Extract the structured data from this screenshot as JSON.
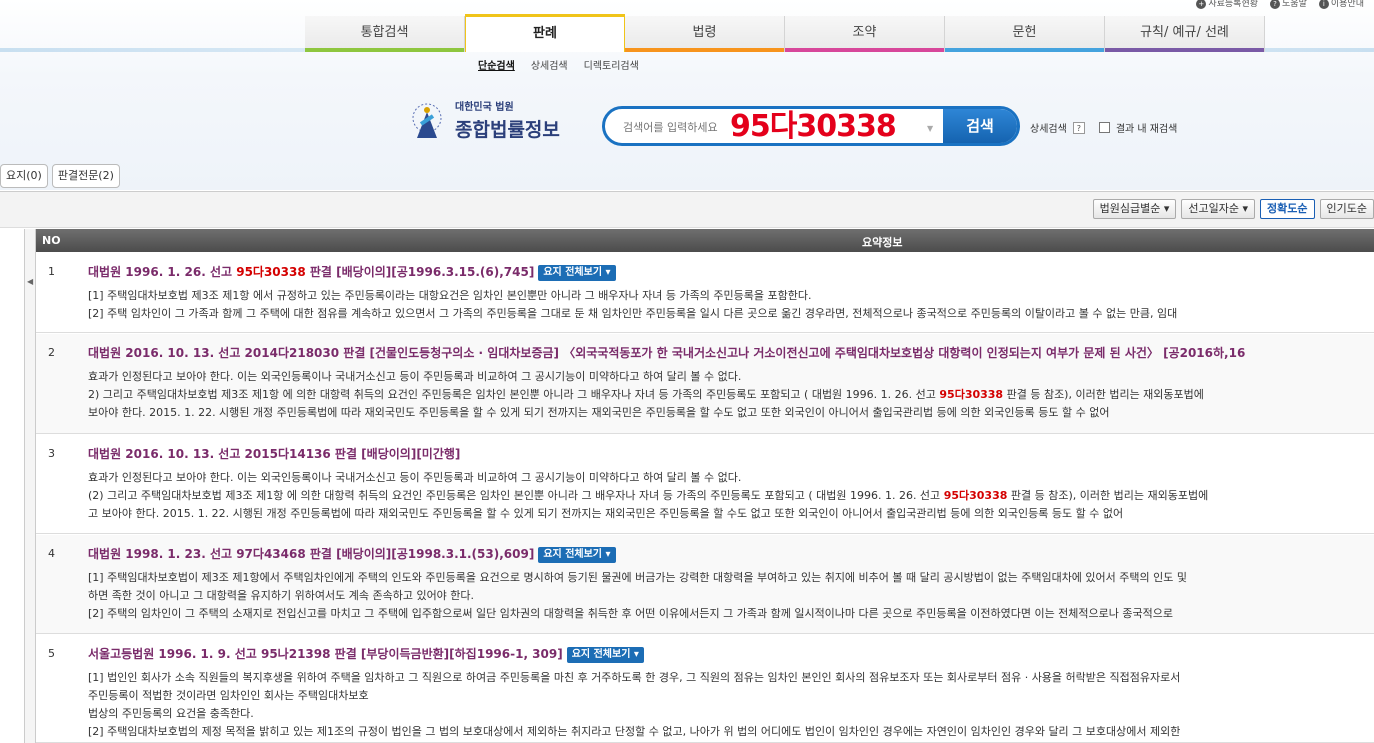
{
  "util": [
    "사료등록현황",
    "도움말",
    "이용안내"
  ],
  "nav": {
    "tabs": [
      {
        "label": "통합검색",
        "color": "#8ec63f"
      },
      {
        "label": "판례",
        "color": "#f0c419",
        "active": true
      },
      {
        "label": "법령",
        "color": "#f7941d"
      },
      {
        "label": "조약",
        "color": "#d7479a"
      },
      {
        "label": "문헌",
        "color": "#45a3de"
      },
      {
        "label": "규칙/ 예규/ 선례",
        "color": "#7a5aa6"
      }
    ],
    "sub": [
      "단순검색",
      "상세검색",
      "디렉토리검색"
    ]
  },
  "logo": {
    "line1": "대한민국 법원",
    "line2": "종합법률정보"
  },
  "search": {
    "placeholder": "검색어를 입력하세요",
    "query": "95다30338",
    "button": "검색"
  },
  "detail": {
    "label": "상세검색",
    "help": "?",
    "recheck": "결과 내 재검색"
  },
  "smalltabs": [
    "요지(0)",
    "판결전문(2)"
  ],
  "sort": [
    "법원심급별순",
    "선고일자순",
    "정확도순",
    "인기도순"
  ],
  "table": {
    "col_no": "NO",
    "col_summary": "요약정보"
  },
  "rows": [
    {
      "no": "1",
      "title_pre": "대법원 1996. 1. 26. 선고 ",
      "title_hl": "95다30338",
      "title_post": " 판결 [배당이의][공1996.3.15.(6),745]",
      "tag": "요지 전체보기 ▾",
      "lines": [
        {
          "t": "[1] 주택임대차보호법 제3조 제1항 에서 규정하고 있는 주민등록이라는 대항요건은 임차인 본인뿐만 아니라 그 배우자나 자녀 등 가족의 주민등록을 포함한다."
        },
        {
          "t": "[2] 주택 임차인이 그 가족과 함께 그 주택에 대한 점유를 계속하고 있으면서 그 가족의 주민등록을 그대로 둔 채 임차인만 주민등록을 일시 다른 곳으로 옮긴 경우라면, 전체적으로나 종국적으로 주민등록의 이탈이라고 볼 수 없는 만큼, 임대"
        }
      ]
    },
    {
      "no": "2",
      "title_pre": "대법원 2016. 10. 13. 선고 2014다218030 판결 [건물인도등청구의소 · 임대차보증금] 〈외국국적동포가 한 국내거소신고나 거소이전신고에 주택임대차보호법상 대항력이 인정되는지 여부가 문제 된 사건〉 [공2016하,16",
      "title_hl": "",
      "title_post": "",
      "tag": "",
      "lines": [
        {
          "t": "효과가 인정된다고 보아야 한다. 이는 외국인등록이나 국내거소신고 등이 주민등록과 비교하여 그 공시기능이 미약하다고 하여 달리 볼 수 없다."
        },
        {
          "pre": "2) 그리고 주택임대차보호법 제3조 제1항 에 의한 대항력 취득의 요건인 주민등록은 임차인 본인뿐 아니라 그 배우자나 자녀 등 가족의 주민등록도 포함되고 ( 대법원 1996. 1. 26. 선고 ",
          "hl": "95다30338",
          "post": " 판결 등 참조), 이러한 법리는 재외동포법에"
        },
        {
          "t": "보아야 한다. 2015. 1. 22. 시행된 개정 주민등록법에 따라 재외국민도 주민등록을 할 수 있게 되기 전까지는 재외국민은 주민등록을 할 수도 없고 또한 외국인이 아니어서 출입국관리법 등에 의한 외국인등록 등도 할 수 없어"
        }
      ]
    },
    {
      "no": "3",
      "title_pre": "대법원 2016. 10. 13. 선고 2015다14136 판결 [배당이의][미간행]",
      "title_hl": "",
      "title_post": "",
      "tag": "",
      "lines": [
        {
          "t": "효과가 인정된다고 보아야 한다. 이는 외국인등록이나 국내거소신고 등이 주민등록과 비교하여 그 공시기능이 미약하다고 하여 달리 볼 수 없다."
        },
        {
          "pre": "(2) 그리고 주택임대차보호법 제3조 제1항 에 의한 대항력 취득의 요건인 주민등록은 임차인 본인뿐 아니라 그 배우자나 자녀 등 가족의 주민등록도 포함되고 ( 대법원 1996. 1. 26. 선고 ",
          "hl": "95다30338",
          "post": " 판결 등 참조), 이러한 법리는 재외동포법에"
        },
        {
          "t": "고 보아야 한다. 2015. 1. 22. 시행된 개정 주민등록법에 따라 재외국민도 주민등록을 할 수 있게 되기 전까지는 재외국민은 주민등록을 할 수도 없고 또한 외국인이 아니어서 출입국관리법 등에 의한 외국인등록 등도 할 수 없어"
        }
      ]
    },
    {
      "no": "4",
      "title_pre": "대법원 1998. 1. 23. 선고 97다43468 판결 [배당이의][공1998.3.1.(53),609]",
      "title_hl": "",
      "title_post": "",
      "tag": "요지 전체보기 ▾",
      "lines": [
        {
          "t": "[1] 주택임대차보호법이 제3조 제1항에서 주택임차인에게 주택의 인도와 주민등록을 요건으로 명시하여 등기된 물권에 버금가는 강력한 대항력을 부여하고 있는 취지에 비추어 볼 때 달리 공시방법이 없는 주택임대차에 있어서 주택의 인도 및"
        },
        {
          "t": "하면 족한 것이 아니고 그 대항력을 유지하기 위하여서도 계속 존속하고 있어야 한다."
        },
        {
          "t": "[2] 주택의 임차인이 그 주택의 소재지로 전입신고를 마치고 그 주택에 입주함으로써 일단 임차권의 대항력을 취득한 후 어떤 이유에서든지 그 가족과 함께 일시적이나마 다른 곳으로 주민등록을 이전하였다면 이는 전체적으로나 종국적으로"
        }
      ]
    },
    {
      "no": "5",
      "title_pre": "서울고등법원 1996. 1. 9. 선고 95나21398 판결 [부당이득금반환][하집1996-1, 309]",
      "title_hl": "",
      "title_post": "",
      "tag": "요지 전체보기 ▾",
      "lines": [
        {
          "t": "[1] 법인인 회사가 소속 직원들의 복지후생을 위하여 주택을 임차하고 그 직원으로 하여금 주민등록을 마친 후 거주하도록 한 경우, 그 직원의 점유는 임차인 본인인 회사의 점유보조자 또는 회사로부터 점유 · 사용을 허락받은 직접점유자로서"
        },
        {
          "t": "주민등록이 적법한 것이라면 임차인인 회사는 주택임대차보호"
        },
        {
          "t": "법상의 주민등록의 요건을 충족한다."
        },
        {
          "t": "[2] 주택임대차보호법의 제정 목적을 밝히고 있는 제1조의 규정이 법인을 그 법의 보호대상에서 제외하는 취지라고 단정할 수 없고, 나아가 위 법의 어디에도 법인이 임차인인 경우에는 자연인이 임차인인 경우와 달리 그 보호대상에서 제외한"
        }
      ]
    }
  ]
}
